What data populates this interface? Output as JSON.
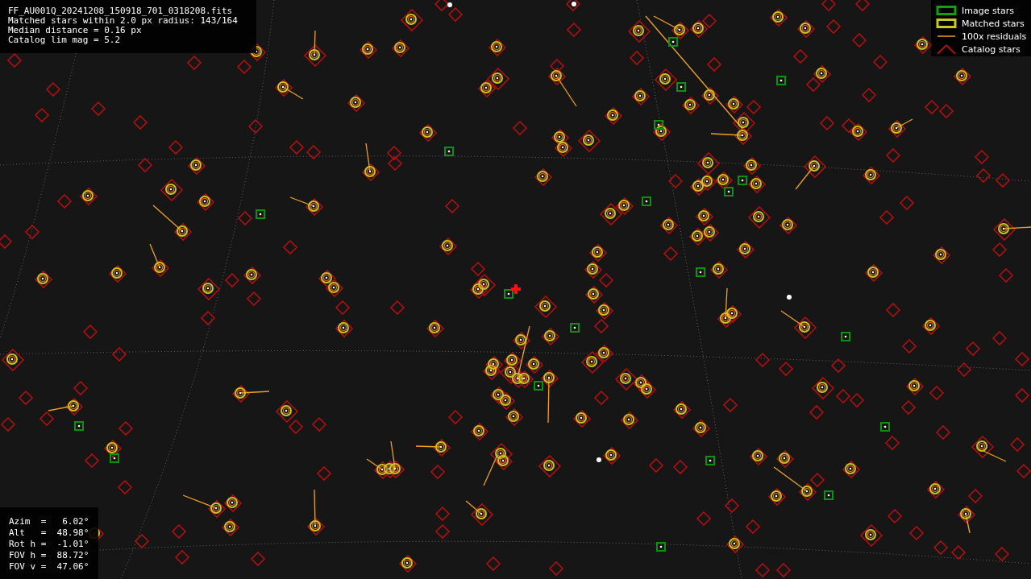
{
  "info_box": {
    "lines": [
      "FF_AU001Q_20241208_150918_701_0318208.fits",
      "Matched stars within 2.0 px radius: 143/164",
      "Median distance = 0.16 px",
      "Catalog lim mag = 5.2"
    ]
  },
  "legend": [
    {
      "kind": "image",
      "label": "Image stars"
    },
    {
      "kind": "matched",
      "label": "Matched stars"
    },
    {
      "kind": "residual",
      "label": "100x residuals"
    },
    {
      "kind": "catalog",
      "label": "Catalog stars"
    }
  ],
  "pointing_box": {
    "lines": [
      "Azim  =   6.02°",
      "Alt   =  48.98°",
      "Rot h =  -1.01°",
      "FOV h =  88.72°",
      "FOV v =  47.06°"
    ]
  }
}
